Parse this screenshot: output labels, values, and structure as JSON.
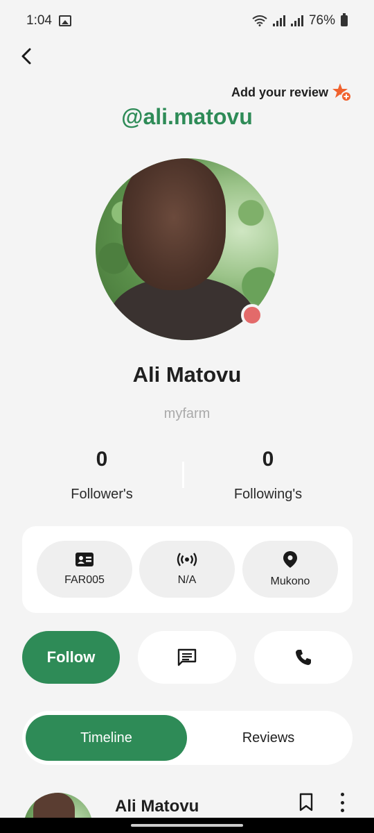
{
  "status_bar": {
    "time": "1:04",
    "battery": "76%"
  },
  "header": {
    "add_review_label": "Add your review",
    "handle": "@ali.matovu"
  },
  "profile": {
    "name": "Ali Matovu",
    "subtitle": "myfarm",
    "online_status_color": "#e36a6a"
  },
  "stats": {
    "followers_count": "0",
    "followers_label": "Follower's",
    "following_count": "0",
    "following_label": "Following's"
  },
  "info_chips": [
    {
      "icon": "id-card-icon",
      "label": "FAR005"
    },
    {
      "icon": "broadcast-icon",
      "label": "N/A"
    },
    {
      "icon": "location-pin-icon",
      "label": "Mukono"
    }
  ],
  "actions": {
    "follow_label": "Follow",
    "message_icon": "message-icon",
    "call_icon": "phone-icon"
  },
  "tabs": [
    {
      "label": "Timeline",
      "active": true
    },
    {
      "label": "Reviews",
      "active": false
    }
  ],
  "post": {
    "author": "Ali Matovu"
  },
  "colors": {
    "accent": "#2e8b57",
    "review_star": "#f0622e",
    "background": "#f4f4f4"
  }
}
